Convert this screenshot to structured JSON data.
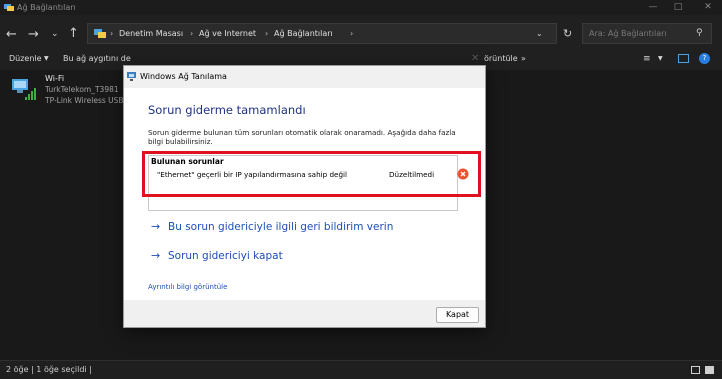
{
  "window": {
    "title": "Ağ Bağlantıları"
  },
  "nav": {
    "breadcrumb": [
      "Denetim Masası",
      "Ağ ve Internet",
      "Ağ Bağlantıları"
    ],
    "search_placeholder": "Ara: Ağ Bağlantıları"
  },
  "command_bar": {
    "organize": "Düzenle",
    "disable": "Bu ağ aygıtını de",
    "view": "örüntüle",
    "more": "»"
  },
  "adapter": {
    "name": "Wi-Fi",
    "network": "TurkTelekom_T3981",
    "device": "TP-Link Wireless USB A"
  },
  "status_bar": {
    "text": "2 öğe  |  1 öğe seçildi  |"
  },
  "dialog": {
    "title": "Windows Ağ Tanılama",
    "heading": "Sorun giderme tamamlandı",
    "description": "Sorun giderme bulunan tüm sorunları otomatik olarak onaramadı. Aşağıda daha fazla bilgi bulabilirsiniz.",
    "issues_header": "Bulunan sorunlar",
    "issues": [
      {
        "text": "\"Ethernet\" geçerli bir IP yapılandırmasına sahip değil",
        "status": "Düzeltilmedi"
      }
    ],
    "feedback_link": "Bu sorun gidericiyle ilgili geri bildirim verin",
    "close_troubleshooter_link": "Sorun gidericiyi kapat",
    "details_link": "Ayrıntılı bilgi görüntüle",
    "close_button": "Kapat"
  },
  "colors": {
    "accent": "#1e4fb8",
    "highlight": "#e0101e",
    "error": "#e8542f"
  }
}
